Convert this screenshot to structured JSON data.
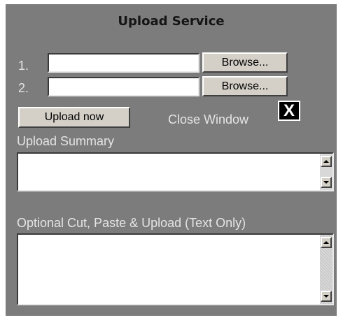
{
  "window": {
    "title": "Upload Service"
  },
  "files": [
    {
      "number": "1.",
      "value": "",
      "browse_label": "Browse..."
    },
    {
      "number": "2.",
      "value": "",
      "browse_label": "Browse..."
    }
  ],
  "actions": {
    "upload_label": "Upload now",
    "close_label": "Close Window",
    "close_glyph": "X"
  },
  "summary": {
    "label": "Upload Summary",
    "value": ""
  },
  "paste": {
    "label": "Optional Cut, Paste & Upload (Text Only)",
    "value": ""
  },
  "colors": {
    "panel": "#7c7c7c",
    "label_text": "#e4e4e4",
    "button_face": "#d4d0c8"
  },
  "icons": [
    "close-icon",
    "scroll-up-arrow-icon",
    "scroll-down-arrow-icon"
  ]
}
